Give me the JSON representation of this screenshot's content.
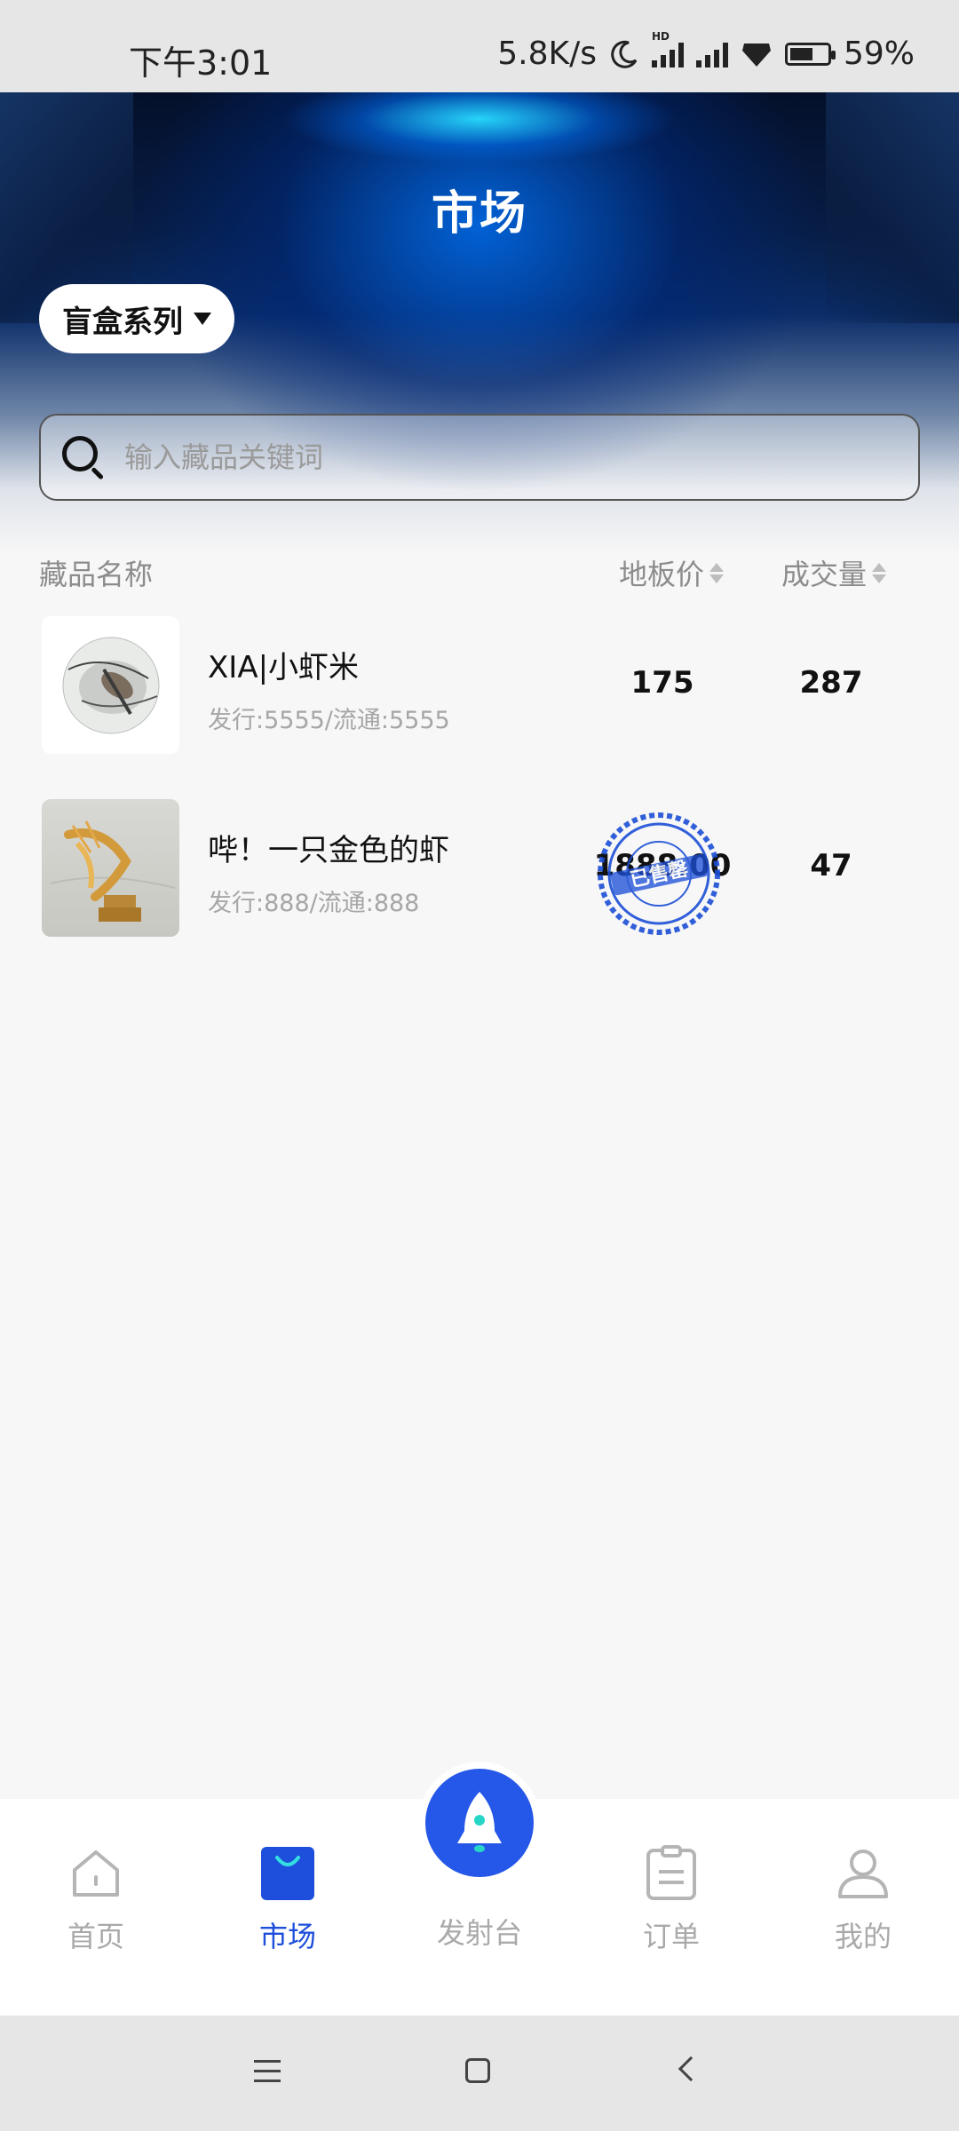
{
  "status_bar": {
    "time": "下午3:01",
    "net_speed": "5.8K/s",
    "hd_badge": "HD",
    "battery": "59%",
    "icons": [
      "moon-icon",
      "signal-icon",
      "signal-icon",
      "vpn-shield-icon",
      "battery-icon"
    ]
  },
  "header": {
    "title": "市场",
    "category_label": "盲盒系列",
    "search_placeholder": "输入藏品关键词"
  },
  "table": {
    "col_name": "藏品名称",
    "col_price": "地板价",
    "col_volume": "成交量",
    "rows": [
      {
        "title": "XIA|小虾米",
        "sub": "发行:5555/流通:5555",
        "price": "175",
        "volume": "287",
        "stamp": false
      },
      {
        "title": "哔！一只金色的虾",
        "sub": "发行:888/流通:888",
        "price": "1888.00",
        "volume": "47",
        "stamp": true,
        "stamp_label": "已售罄"
      }
    ]
  },
  "bottom_nav": {
    "items": [
      {
        "label": "首页",
        "icon": "home-icon",
        "active": false
      },
      {
        "label": "市场",
        "icon": "shopping-bag-icon",
        "active": true
      },
      {
        "label": "发射台",
        "icon": "rocket-icon",
        "active": false
      },
      {
        "label": "订单",
        "icon": "clipboard-icon",
        "active": false
      },
      {
        "label": "我的",
        "icon": "user-icon",
        "active": false
      }
    ]
  },
  "colors": {
    "accent": "#2557e8",
    "active_tab": "#1e4fdc",
    "muted_text": "#a6a6a6"
  }
}
